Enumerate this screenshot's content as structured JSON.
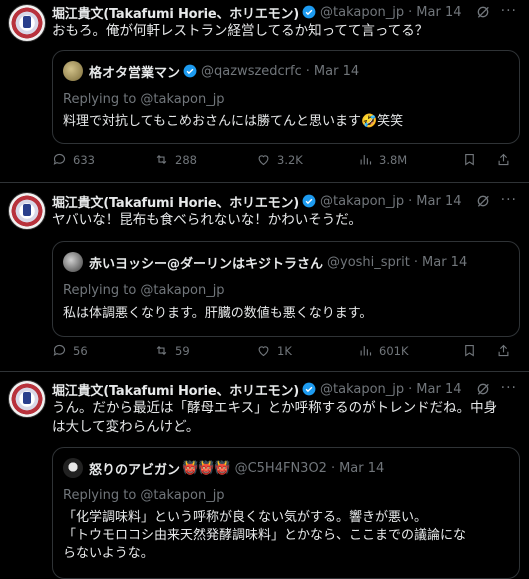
{
  "colors": {
    "background": "#000000",
    "text": "#e7e9ea",
    "muted": "#71767b",
    "divider": "#2f3336",
    "verified": "#1d9bf0"
  },
  "tweets": [
    {
      "author": {
        "name": "堀江貴文(Takafumi Horie、ホリエモン)",
        "handle": "@takapon_jp",
        "date": "Mar 14"
      },
      "text": "おもろ。俺が何軒レストラン経営してるか知ってて言ってる？",
      "quote": {
        "name": "格オタ営業マン",
        "handle": "@qazwszedcrfc",
        "date": "Mar 14",
        "replying": "Replying to @takapon_jp",
        "lines": [
          "料理で対抗してもこめおさんには勝てんと思います🤣笑笑"
        ]
      },
      "stats": {
        "replies": "633",
        "reposts": "288",
        "likes": "3.2K",
        "views": "3.8M"
      }
    },
    {
      "author": {
        "name": "堀江貴文(Takafumi Horie、ホリエモン)",
        "handle": "@takapon_jp",
        "date": "Mar 14"
      },
      "text": "ヤバいな！昆布も食べられないな！かわいそうだ。",
      "quote": {
        "name": "赤いヨッシー@ダーリンはキジトラさん",
        "handle": "@yoshi_sprit",
        "date": "Mar 14",
        "replying": "Replying to @takapon_jp",
        "lines": [
          "私は体調悪くなります。肝臓の数値も悪くなります。"
        ]
      },
      "stats": {
        "replies": "56",
        "reposts": "59",
        "likes": "1K",
        "views": "601K"
      }
    },
    {
      "author": {
        "name": "堀江貴文(Takafumi Horie、ホリエモン)",
        "handle": "@takapon_jp",
        "date": "Mar 14"
      },
      "text_lines": [
        "うん。だから最近は「酵母エキス」とか呼称するのがトレンドだね。中身",
        "は大して変わらんけど。"
      ],
      "quote": {
        "name": "怒りのアビガン",
        "name_emoji": "👹👹👹",
        "handle": "@C5H4FN3O2",
        "date": "Mar 14",
        "replying": "Replying to @takapon_jp",
        "lines": [
          "「化学調味料」という呼称が良くない気がする。響きが悪い。",
          "「トウモロコシ由来天然発酵調味料」とかなら、ここまでの議論にな",
          "らないような。"
        ]
      }
    }
  ],
  "separator": "·",
  "icons": [
    "verified-badge-icon",
    "grok-icon",
    "more-icon",
    "reply-icon",
    "repost-icon",
    "like-icon",
    "views-icon",
    "bookmark-icon",
    "share-icon"
  ]
}
